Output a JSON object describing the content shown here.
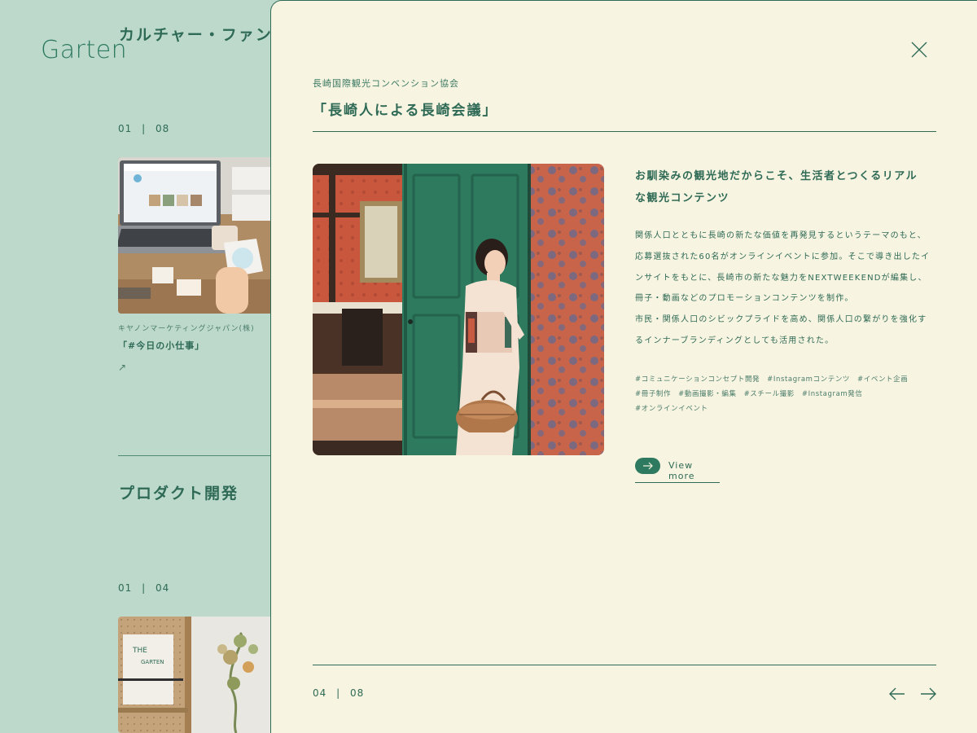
{
  "brand": {
    "logo_text": "Garten"
  },
  "background": {
    "section1": {
      "heading": "カルチャー・ファン",
      "counter_current": "01",
      "counter_sep": "|",
      "counter_total": "08"
    },
    "card": {
      "client": "キヤノンマーケティングジャパン(株)",
      "title": "「#今日の小仕事」",
      "arrow": "↗"
    },
    "section2": {
      "heading": "プロダクト開発",
      "counter_current": "01",
      "counter_sep": "|",
      "counter_total": "04"
    }
  },
  "modal": {
    "client": "長崎国際観光コンベンション協会",
    "title": "「長崎人による長崎会議」",
    "lead_lines": [
      "お馴染みの観光地だからこそ、生活者とつくるリアル",
      "な観光コンテンツ"
    ],
    "body_lines": [
      "関係人口とともに長崎の新たな価値を再発見するというテーマのもと、",
      "応募選抜された60名がオンラインイベントに参加。そこで導き出したイ",
      "ンサイトをもとに、長崎市の新たな魅力をNEXTWEEKENDが編集し、",
      "冊子・動画などのプロモーションコンテンツを制作。",
      "市民・関係人口のシビックプライドを高め、関係人口の繋がりを強化す",
      "るインナーブランディングとしても活用された。"
    ],
    "tags": [
      "#コミュニケーションコンセプト開発",
      "#Instagramコンテンツ",
      "#イベント企画",
      "#冊子制作",
      "#動画撮影・編集",
      "#スチール撮影",
      "#Instagram発信",
      "#オンラインイベント"
    ],
    "view_more_label": "View more",
    "counter_current": "04",
    "counter_sep": "|",
    "counter_total": "08"
  },
  "icons": {
    "close": "close-icon",
    "prev": "arrow-left-icon",
    "next": "arrow-right-icon",
    "view_more": "arrow-right-icon"
  },
  "colors": {
    "page_bg": "#bcd9cc",
    "modal_bg": "#f7f4e1",
    "accent": "#2e6a55",
    "pill": "#2e7a60"
  }
}
